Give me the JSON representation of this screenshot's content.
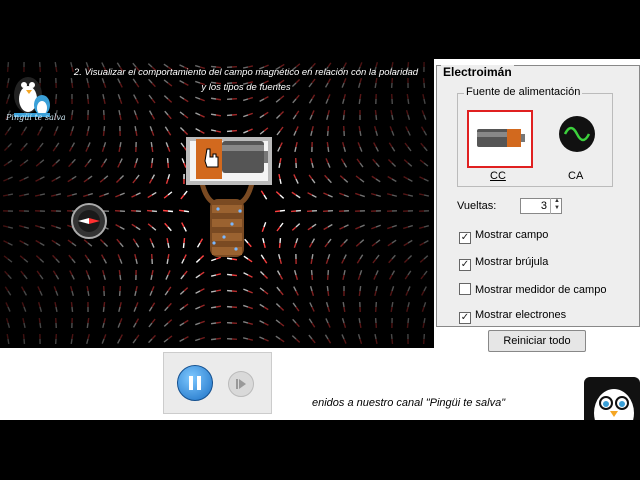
{
  "video": {
    "caption_line1": "2. Visualizar el comportamiento del campo magnético en relación con la polaridad",
    "caption_line2": "y los tipos de fuentes",
    "logo_text": "Pingüi te salva",
    "marquee": "enidos a nuestro canal \"Pingüi te salva\""
  },
  "panel": {
    "title": "Electroimán",
    "source_group_label": "Fuente de alimentación",
    "source_dc_label": "CC",
    "source_ac_label": "CA",
    "turns_label": "Vueltas:",
    "turns_value": "3",
    "checks": [
      {
        "label": "Mostrar campo",
        "checked": true
      },
      {
        "label": "Mostrar brújula",
        "checked": true
      },
      {
        "label": "Mostrar medidor de campo",
        "checked": false
      },
      {
        "label": "Mostrar electrones",
        "checked": true
      }
    ],
    "reset_label": "Reiniciar todo"
  },
  "controls": {
    "play_state": "paused"
  },
  "colors": {
    "selected_border": "#e02020",
    "pause_button": "#1a6fc4",
    "field_needle_north": "#ff4040",
    "field_needle_south": "#ffffff"
  },
  "icons": [
    "battery-icon",
    "ac-source-icon",
    "pause-icon",
    "step-icon",
    "compass-icon",
    "hand-cursor-icon"
  ]
}
